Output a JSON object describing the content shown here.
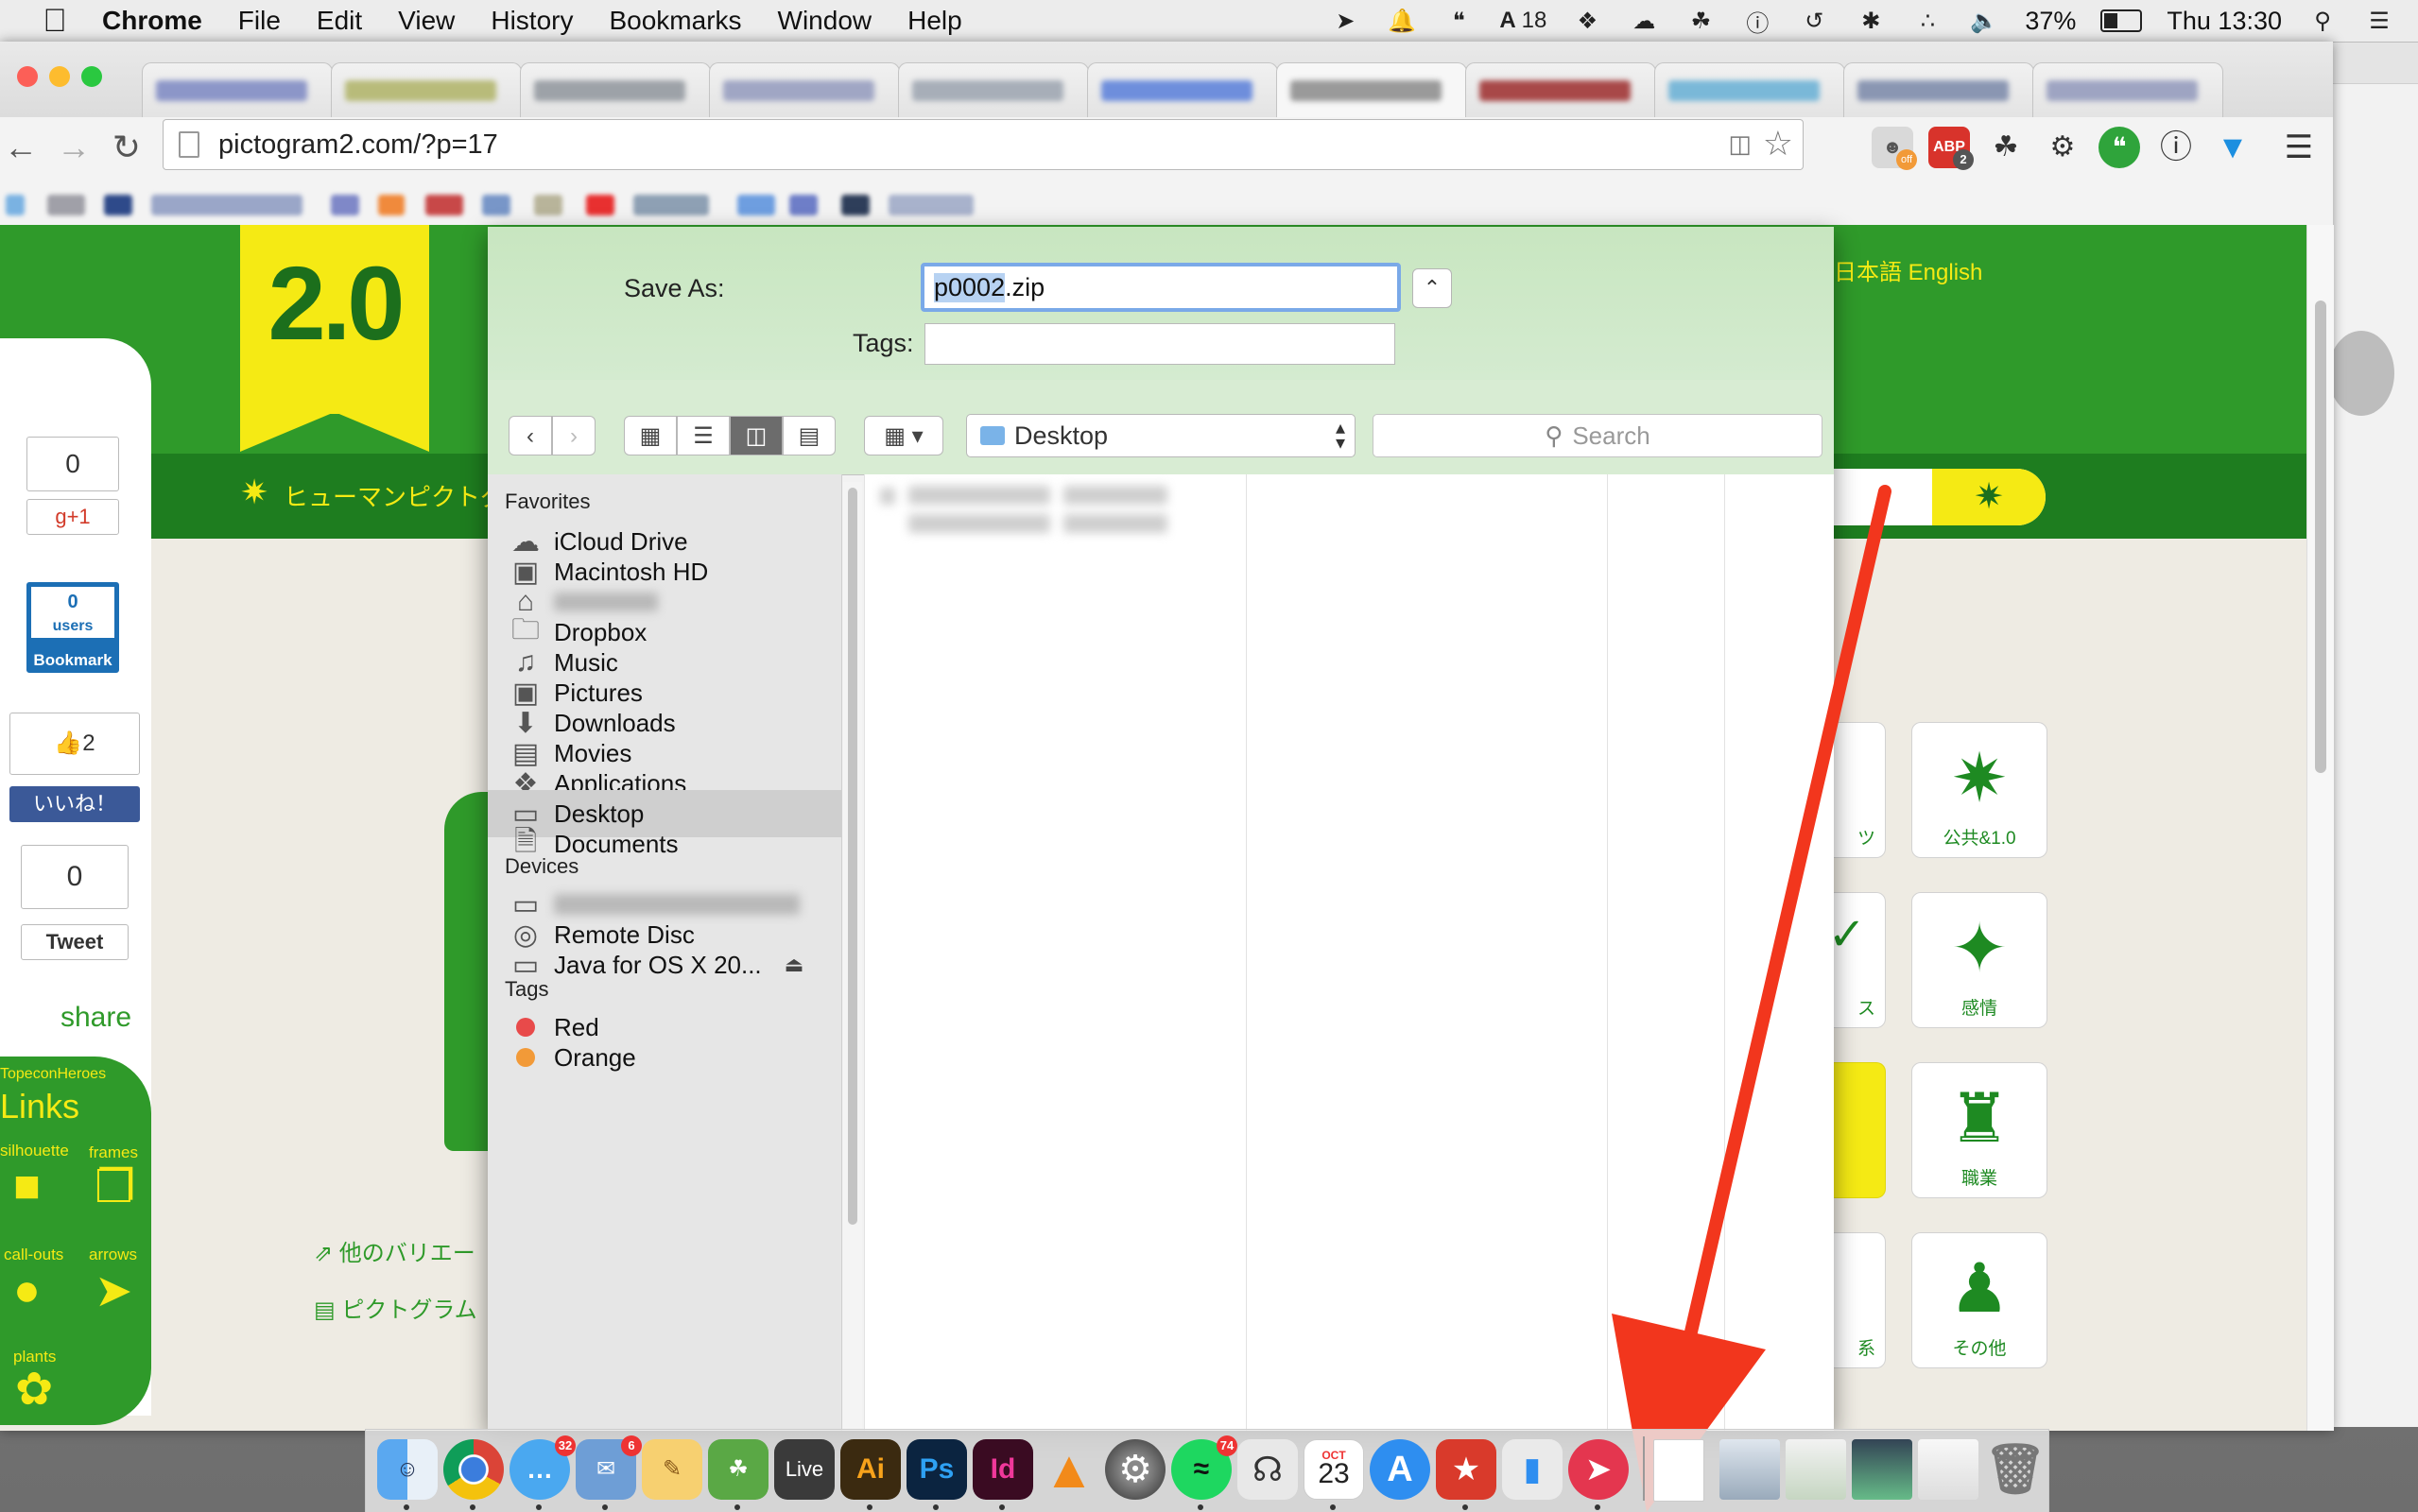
{
  "menubar": {
    "app": "Chrome",
    "items": [
      "File",
      "Edit",
      "View",
      "History",
      "Bookmarks",
      "Window",
      "Help"
    ],
    "status": {
      "adobe_count": "18",
      "battery": "37%",
      "clock": "Thu 13:30"
    }
  },
  "browser": {
    "url": "pictogram2.com/?p=17",
    "ext_abp_badge": "2",
    "ext_off_label": "off"
  },
  "page": {
    "logo_text": "2.0",
    "nav_text": "ヒューマンピクトグ",
    "language_link": "日本語  English",
    "social": {
      "gplus_count": "0",
      "gplus_label": "g+1",
      "hatena_count": "0",
      "hatena_users": "users",
      "hatena_label": "Bookmark",
      "fb_count": "2",
      "fb_label": "いいね！",
      "tweet_count": "0",
      "tweet_label": "Tweet",
      "share": "share"
    },
    "links_heading": "Links",
    "links_sub": "TopeconHeroes",
    "link_categories": [
      "silhouette",
      "frames",
      "call-outs",
      "arrows",
      "plants"
    ],
    "side_links": [
      "他のバリエー",
      "ピクトグラム"
    ],
    "tiles": [
      {
        "caption": "公共&1.0"
      },
      {
        "caption": "感情"
      },
      {
        "caption": "職業"
      },
      {
        "caption": "その他"
      }
    ],
    "partial_captions": [
      "ツ",
      "ス",
      "系"
    ]
  },
  "save_dialog": {
    "save_as_label": "Save As:",
    "filename_selected": "p0002",
    "filename_ext": ".zip",
    "tags_label": "Tags:",
    "tags_value": "",
    "location": "Desktop",
    "search_placeholder": "Search",
    "sidebar": {
      "favorites_header": "Favorites",
      "favorites": [
        "iCloud Drive",
        "Macintosh HD",
        "Dropbox",
        "Music",
        "Pictures",
        "Downloads",
        "Movies",
        "Applications",
        "Desktop",
        "Documents"
      ],
      "selected": "Desktop",
      "devices_header": "Devices",
      "devices": [
        "Remote Disc",
        "Java for OS X 20..."
      ],
      "tags_header": "Tags",
      "tags": [
        {
          "name": "Red",
          "color": "#e84a4a"
        },
        {
          "name": "Orange",
          "color": "#f29a38"
        }
      ]
    }
  },
  "dock": {
    "badges": {
      "messages": "32",
      "mail": "6",
      "spotify": "74"
    },
    "calendar_month": "OCT",
    "calendar_day": "23",
    "live_label": "Live",
    "ai_label": "Ai",
    "ps_label": "Ps",
    "id_label": "Id"
  },
  "colors": {
    "site_green": "#2f9a2a",
    "site_yellow": "#f5ea14",
    "arrow_red": "#f2361d",
    "dialog_tint": "#d4ebd0"
  }
}
